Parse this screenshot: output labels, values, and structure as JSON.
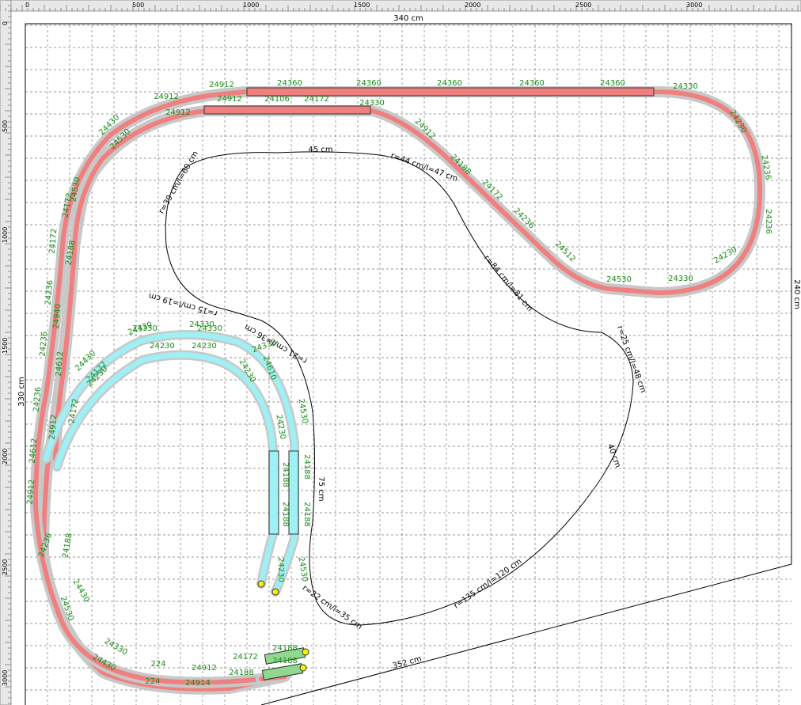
{
  "rulers": {
    "top": [
      "0",
      "500",
      "1000",
      "1500",
      "2000",
      "2500",
      "3000"
    ],
    "left": [
      "0",
      "500",
      "1000",
      "1500",
      "2000",
      "2500",
      "3000"
    ]
  },
  "dimensions": {
    "top_width": "340 cm",
    "right_height": "240 cm",
    "left_height": "330 cm",
    "diagonal": "352 cm",
    "inner_top": "45 cm",
    "vertical_75": "75 cm",
    "vertical_40": "40 cm"
  },
  "curve_labels": {
    "r39": "r=39 cm/l=60 cm",
    "r44": "r=44 cm/l=47 cm",
    "r84": "r=84 cm/l=81 cm",
    "r25": "r=25 cm/l=48 cm",
    "r15": "r=15 cm/l=19 cm",
    "r21": "r=21 cm/l=36 cm",
    "r135": "r=135 cm/l=120 cm",
    "r22": "r=22 cm/l=35 cm"
  },
  "track_labels": {
    "straight_top": [
      "24360",
      "24360",
      "24360",
      "24360",
      "24360"
    ],
    "top_inner": [
      "24912",
      "24106",
      "24172",
      "24330"
    ],
    "top_left": [
      "24912",
      "24912",
      "24912"
    ],
    "right_loop": [
      "24330",
      "24230",
      "24236",
      "24236",
      "24230",
      "24330"
    ],
    "diagonal": [
      "24912",
      "24188",
      "24172",
      "24236",
      "24512",
      "24530"
    ],
    "left_outer": [
      "24430",
      "24530",
      "24530",
      "24172",
      "24236",
      "24236",
      "24236",
      "24612",
      "24912"
    ],
    "left_inner": [
      "24330",
      "24430",
      "24172",
      "24172",
      "24172",
      "24188",
      "24940",
      "24612",
      "24912",
      "24236",
      "24188"
    ],
    "bottom": [
      "24430",
      "24530",
      "24330",
      "24430",
      "224",
      "224",
      "24912",
      "24914",
      "24172",
      "24188",
      "24188",
      "24188"
    ],
    "cyan_outer": [
      "24330",
      "24330",
      "24330",
      "24330",
      "24610",
      "24530",
      "24188",
      "24188",
      "24530"
    ],
    "cyan_inner": [
      "24230",
      "24230",
      "24230",
      "24230",
      "24230",
      "24188",
      "24188",
      "24230"
    ]
  },
  "colors": {
    "main_track": "#f08080",
    "main_track_shadow": "#c8c8c8",
    "branch_track": "#9ff0f5",
    "label_green": "#1a8a1a",
    "grid": "#7a7a7a",
    "ruler_bg": "#e8e8e8",
    "buffer_green": "#90d890",
    "end_marker": "#f5f500"
  }
}
